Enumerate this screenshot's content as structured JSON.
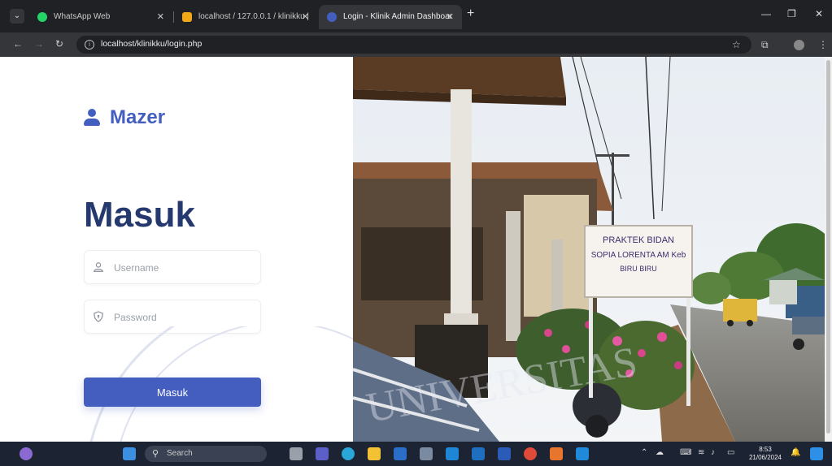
{
  "browser": {
    "tabs": [
      {
        "title": "WhatsApp Web",
        "favicon_color": "#25d366",
        "active": false
      },
      {
        "title": "localhost / 127.0.0.1 / klinikku |",
        "favicon_color": "#f0a818",
        "active": false
      },
      {
        "title": "Login - Klinik Admin Dashboar",
        "favicon_color": "#435ebe",
        "active": true
      }
    ],
    "url": "localhost/klinikku/login.php"
  },
  "brand": {
    "name": "Mazer",
    "color": "#435ebe"
  },
  "login": {
    "title": "Masuk",
    "username_placeholder": "Username",
    "password_placeholder": "Password",
    "submit_label": "Masuk",
    "title_color": "#25396f"
  },
  "photo": {
    "sign_line1": "PRAKTEK BIDAN",
    "sign_line2": "SOPIA LORENTA AM Keb",
    "sign_line3": "BIRU BIRU"
  },
  "watermark": {
    "text": "UNIVERSITAS"
  },
  "taskbar": {
    "search_label": "Search",
    "time": "8:53",
    "date": "21/06/2024"
  }
}
